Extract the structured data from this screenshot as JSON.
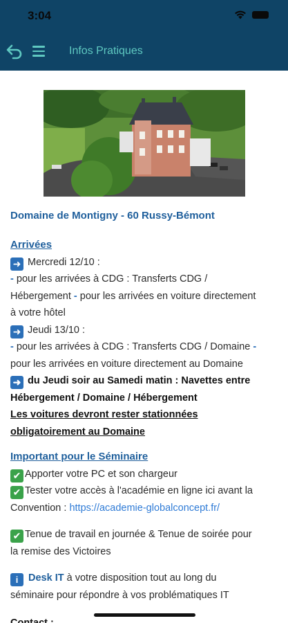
{
  "status_bar": {
    "time": "3:04"
  },
  "app_bar": {
    "title": "Infos Pratiques"
  },
  "venue": {
    "title": "Domaine de Montigny - 60 Russy-Bémont"
  },
  "arrivals": {
    "title": "Arrivées",
    "day1_label": "Mercredi 12/10 :",
    "day1_line1": "pour les arrivées à CDG : Transferts CDG /",
    "day1_line2_a": "Hébergement",
    "day1_line2_b": "pour les arrivées en voiture directement",
    "day1_line3": "à votre hôtel",
    "day2_label": "Jeudi 13/10 :",
    "day2_line1": "pour les arrivées à CDG : Transferts CDG / Domaine",
    "day2_line2": "pour les arrivées en voiture directement au Domaine",
    "shuttle_line1": "du Jeudi soir au Samedi matin : Navettes entre",
    "shuttle_line2": "Hébergement / Domaine / Hébergement",
    "parking_line1": "Les voitures devront rester stationnées",
    "parking_line2": "obligatoirement au Domaine"
  },
  "seminar": {
    "title": "Important pour le Séminaire",
    "item1": "Apporter votre PC et son chargeur",
    "item2_line1": "Tester votre accès à l'académie en ligne ici avant la",
    "item2_line2_prefix": "Convention : ",
    "item2_link": "https://academie-globalconcept.fr/",
    "item3_line1": "Tenue de travail en journée & Tenue de soirée pour",
    "item3_line2": "la remise des Victoires"
  },
  "desk": {
    "name": "Desk IT",
    "line1_rest": " à votre disposition tout au long du",
    "line2": "séminaire pour répondre à vos problématiques IT"
  },
  "contact": {
    "label": "Contact :"
  },
  "icons": {
    "back": "back-arrow-icon",
    "menu": "hamburger-menu-icon",
    "arrow": "right-arrow-emoji",
    "check": "check-mark-emoji",
    "info": "information-emoji"
  },
  "colors": {
    "header_bg": "#0f4466",
    "header_accent": "#5fc9c1",
    "heading_blue": "#1f5f9c",
    "link_blue": "#2f7bd6"
  }
}
